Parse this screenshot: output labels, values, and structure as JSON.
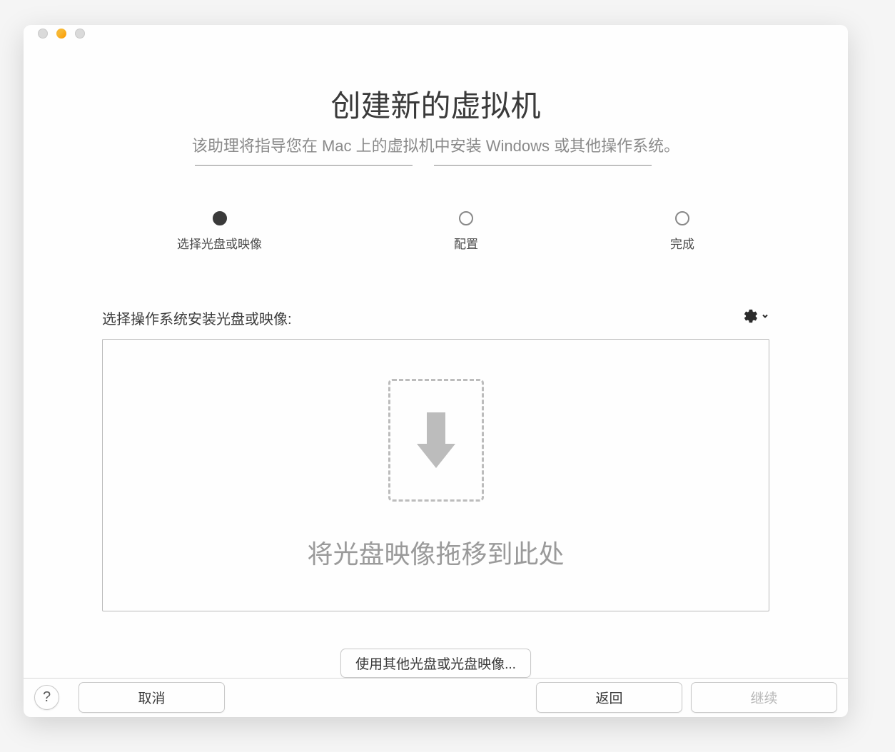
{
  "header": {
    "title": "创建新的虚拟机",
    "subtitle": "该助理将指导您在 Mac 上的虚拟机中安装 Windows 或其他操作系统。"
  },
  "stepper": {
    "steps": [
      {
        "label": "选择光盘或映像",
        "active": true
      },
      {
        "label": "配置",
        "active": false
      },
      {
        "label": "完成",
        "active": false
      }
    ]
  },
  "section": {
    "label": "选择操作系统安装光盘或映像:",
    "dropzone_text": "将光盘映像拖移到此处"
  },
  "buttons": {
    "choose": "使用其他光盘或光盘映像...",
    "help": "?",
    "cancel": "取消",
    "back": "返回",
    "continue": "继续"
  }
}
